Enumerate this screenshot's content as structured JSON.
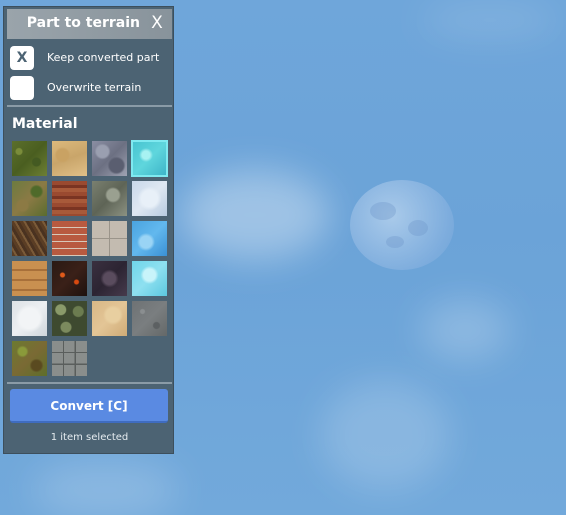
{
  "panel": {
    "title": "Part to terrain",
    "close_label": "X"
  },
  "options": [
    {
      "label": "Keep converted part",
      "checked": true,
      "mark": "X"
    },
    {
      "label": "Overwrite terrain",
      "checked": false,
      "mark": ""
    }
  ],
  "material": {
    "heading": "Material",
    "selected_index": 3,
    "items": [
      {
        "name": "Grass",
        "texture": "grass"
      },
      {
        "name": "Sand",
        "texture": "sand"
      },
      {
        "name": "Rock",
        "texture": "rock"
      },
      {
        "name": "Water",
        "texture": "water"
      },
      {
        "name": "LeafyGrass",
        "texture": "leafy"
      },
      {
        "name": "WoodPlanks",
        "texture": "wood"
      },
      {
        "name": "Slate",
        "texture": "slate"
      },
      {
        "name": "Glacier",
        "texture": "glacier"
      },
      {
        "name": "Mud",
        "texture": "mud"
      },
      {
        "name": "Brick",
        "texture": "brick"
      },
      {
        "name": "Concrete",
        "texture": "concrete"
      },
      {
        "name": "Ice",
        "texture": "ice"
      },
      {
        "name": "WoodPlanksLight",
        "texture": "wplank"
      },
      {
        "name": "CrackedLava",
        "texture": "lava"
      },
      {
        "name": "Basalt",
        "texture": "basalt"
      },
      {
        "name": "Ice2",
        "texture": "cice"
      },
      {
        "name": "Snow",
        "texture": "snow"
      },
      {
        "name": "Cobblestone",
        "texture": "cobble"
      },
      {
        "name": "Sandstone",
        "texture": "sandstone"
      },
      {
        "name": "Asphalt",
        "texture": "asphalt"
      },
      {
        "name": "Ground",
        "texture": "ground"
      },
      {
        "name": "Pavement",
        "texture": "pavement"
      }
    ]
  },
  "convert_label": "Convert [C]",
  "status": "1 item selected",
  "colors": {
    "panel_bg": "#4c6373",
    "accent": "#5a8ae2",
    "selection": "#7fe9f0"
  }
}
